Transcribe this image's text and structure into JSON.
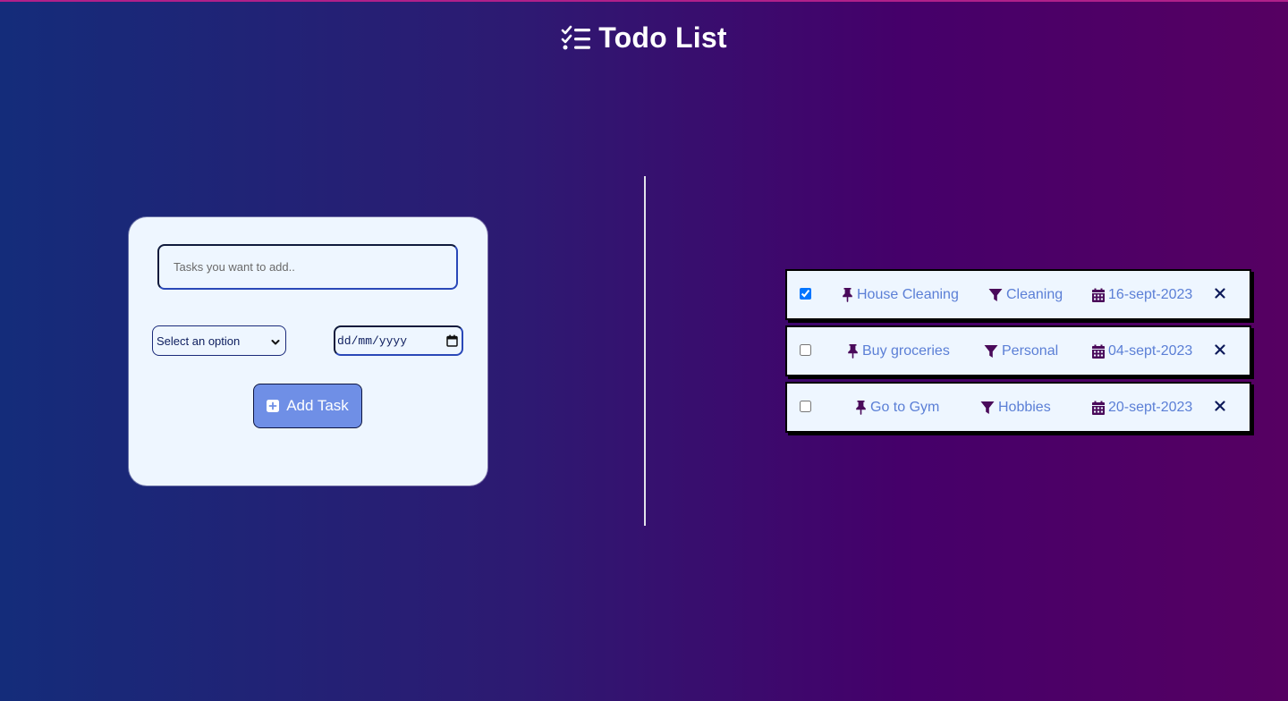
{
  "app": {
    "title": "Todo List",
    "accent_color": "#6f8fe6",
    "icon_color": "#4a0a5a"
  },
  "form": {
    "task_placeholder": "Tasks you want to add..",
    "category_selected": "Select an option",
    "date_placeholder": "dd/mm/yyyy",
    "add_button_label": "Add Task"
  },
  "tasks": [
    {
      "name": "House Cleaning",
      "category": "Cleaning",
      "date": "16-sept-2023",
      "done": true
    },
    {
      "name": "Buy groceries",
      "category": "Personal",
      "date": "04-sept-2023",
      "done": false
    },
    {
      "name": "Go to Gym",
      "category": "Hobbies",
      "date": "20-sept-2023",
      "done": false
    }
  ],
  "icons": {
    "title": "list-check-icon",
    "add": "plus-square-icon",
    "name": "thumbtack-icon",
    "category": "filter-icon",
    "date": "calendar-icon",
    "delete": "close-icon",
    "select": "chevron-down-icon",
    "date_picker": "calendar-picker-icon"
  }
}
